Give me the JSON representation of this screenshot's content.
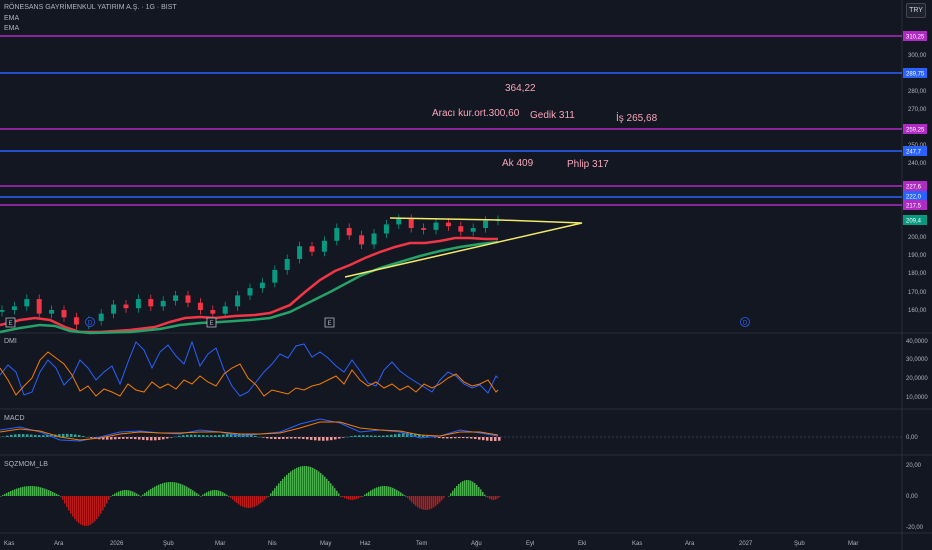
{
  "header": {
    "symbol_title": "RÖNESANS GAYRİMENKUL YATIRIM A.Ş. · 1G · BIST",
    "indicators": [
      "EMA",
      "EMA"
    ],
    "currency": "TRY"
  },
  "colors": {
    "background": "#131722",
    "grid": "#1e222d",
    "purple_line": "#b02ac4",
    "blue_line": "#2962ff",
    "trendline": "#f2e96a",
    "ema_fast": "#f23645",
    "ema_slow": "#26a269",
    "candle_up": "#089981",
    "candle_down": "#f23645",
    "dmi_plus": "#2962ff",
    "dmi_minus": "#f57c00",
    "mom_up": "#4caf50",
    "mom_down": "#f23645"
  },
  "annotations": [
    {
      "text": "364,22"
    },
    {
      "text": "Aracı kur.ort.300,60"
    },
    {
      "text": "Gedik 311"
    },
    {
      "text": "İş 265,68"
    },
    {
      "text": "Ak 409"
    },
    {
      "text": "Phlip 317"
    }
  ],
  "price_axis": {
    "ticks": [
      "300,00",
      "280,00",
      "270,00",
      "250,00",
      "240,00",
      "200,00",
      "190,00",
      "180,00",
      "170,00",
      "160,00"
    ],
    "badges": [
      {
        "label": "310,25",
        "color": "#b02ac4"
      },
      {
        "label": "289,75",
        "color": "#2962ff"
      },
      {
        "label": "259,25",
        "color": "#b02ac4"
      },
      {
        "label": "247,7",
        "color": "#2962ff"
      },
      {
        "label": "227,6",
        "color": "#b02ac4"
      },
      {
        "label": "222,0",
        "color": "#2962ff"
      },
      {
        "label": "217,5",
        "color": "#b02ac4"
      },
      {
        "label": "209,4",
        "color": "#089981"
      }
    ]
  },
  "dmi": {
    "label": "DMI",
    "ticks": [
      "40,0000",
      "30,0000",
      "20,0000",
      "10,0000"
    ]
  },
  "macd": {
    "label": "MACD",
    "ticks": [
      "0,00"
    ]
  },
  "sqzmom": {
    "label": "SQZMOM_LB",
    "ticks": [
      "20,00",
      "0,00",
      "-20,00"
    ]
  },
  "time_axis": [
    "Kas",
    "Ara",
    "2026",
    "Şub",
    "Mar",
    "Nis",
    "May",
    "Haz",
    "Tem",
    "Ağu",
    "Eyl",
    "Eki",
    "Kas",
    "Ara",
    "2027",
    "Şub",
    "Mar"
  ],
  "event_markers": [
    "E",
    "D",
    "E",
    "E",
    "D"
  ],
  "chart_data": {
    "type": "line",
    "title": "RÖNESANS GAYRİMENKUL YATIRIM A.Ş. · 1G · BIST",
    "horizontal_levels": [
      310.25,
      289.75,
      259.25,
      247.7,
      227.6,
      222.0,
      217.5
    ],
    "last_price": 209.4,
    "close_approx": [
      160,
      162,
      166,
      158,
      160,
      156,
      152,
      154,
      158,
      163,
      161,
      166,
      162,
      165,
      168,
      164,
      160,
      158,
      162,
      168,
      172,
      175,
      182,
      188,
      195,
      192,
      198,
      205,
      201,
      196,
      202,
      207,
      210,
      205,
      204,
      208,
      206,
      203,
      205,
      209,
      209.4
    ]
  }
}
